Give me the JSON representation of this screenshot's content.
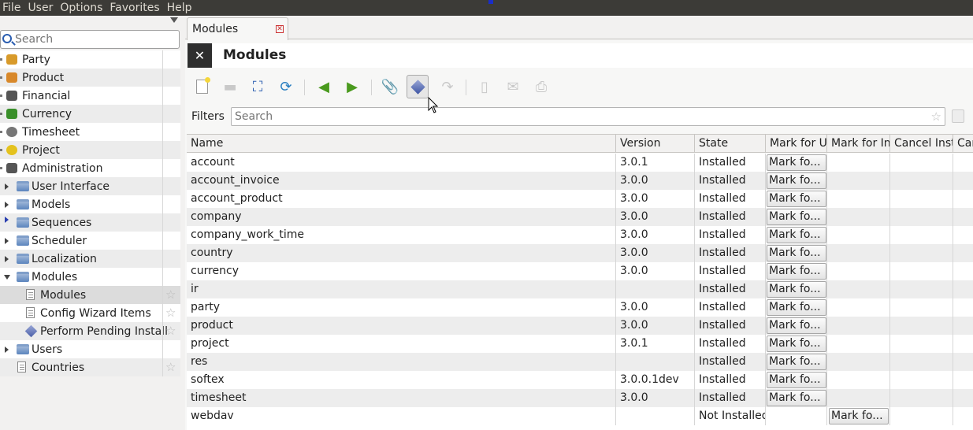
{
  "menubar": {
    "items": [
      "File",
      "User",
      "Options",
      "Favorites",
      "Help"
    ]
  },
  "sidebar": {
    "search_placeholder": "Search",
    "items": [
      {
        "label": "Party",
        "icon": "party-icon",
        "color": "#d89a2a"
      },
      {
        "label": "Product",
        "icon": "product-icon",
        "color": "#d8882a"
      },
      {
        "label": "Financial",
        "icon": "calculator-icon",
        "color": "#555555"
      },
      {
        "label": "Currency",
        "icon": "currency-icon",
        "color": "#3a8f2a"
      },
      {
        "label": "Timesheet",
        "icon": "clock-icon",
        "color": "#777777"
      },
      {
        "label": "Project",
        "icon": "project-icon",
        "color": "#e4c21e"
      },
      {
        "label": "Administration",
        "icon": "tools-icon",
        "color": "#555555"
      },
      {
        "label": "User Interface",
        "icon": "folder-icon"
      },
      {
        "label": "Models",
        "icon": "folder-icon"
      },
      {
        "label": "Sequences",
        "icon": "folder-icon"
      },
      {
        "label": "Scheduler",
        "icon": "folder-icon"
      },
      {
        "label": "Localization",
        "icon": "folder-icon"
      },
      {
        "label": "Modules",
        "icon": "folder-icon"
      },
      {
        "label": "Modules",
        "icon": "document-icon"
      },
      {
        "label": "Config Wizard Items",
        "icon": "document-icon"
      },
      {
        "label": "Perform Pending Install",
        "icon": "diamond-icon"
      },
      {
        "label": "Users",
        "icon": "folder-icon"
      },
      {
        "label": "Countries",
        "icon": "document-icon"
      }
    ]
  },
  "tab": {
    "label": "Modules"
  },
  "content": {
    "title": "Modules"
  },
  "filters": {
    "label": "Filters",
    "placeholder": "Search"
  },
  "table": {
    "headers": [
      "Name",
      "Version",
      "State",
      "Mark for Up",
      "Mark for In",
      "Cancel Insta",
      "Car"
    ],
    "button_label": "Mark fo...",
    "rows": [
      {
        "name": "account",
        "version": "3.0.1",
        "state": "Installed"
      },
      {
        "name": "account_invoice",
        "version": "3.0.0",
        "state": "Installed"
      },
      {
        "name": "account_product",
        "version": "3.0.0",
        "state": "Installed"
      },
      {
        "name": "company",
        "version": "3.0.0",
        "state": "Installed"
      },
      {
        "name": "company_work_time",
        "version": "3.0.0",
        "state": "Installed"
      },
      {
        "name": "country",
        "version": "3.0.0",
        "state": "Installed"
      },
      {
        "name": "currency",
        "version": "3.0.0",
        "state": "Installed"
      },
      {
        "name": "ir",
        "version": "",
        "state": "Installed"
      },
      {
        "name": "party",
        "version": "3.0.0",
        "state": "Installed"
      },
      {
        "name": "product",
        "version": "3.0.0",
        "state": "Installed"
      },
      {
        "name": "project",
        "version": "3.0.1",
        "state": "Installed"
      },
      {
        "name": "res",
        "version": "",
        "state": "Installed"
      },
      {
        "name": "softex",
        "version": "3.0.0.1dev",
        "state": "Installed"
      },
      {
        "name": "timesheet",
        "version": "3.0.0",
        "state": "Installed"
      },
      {
        "name": "webdav",
        "version": "",
        "state": "Not Installed"
      }
    ]
  }
}
